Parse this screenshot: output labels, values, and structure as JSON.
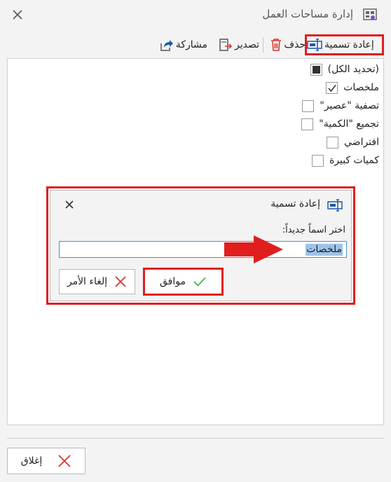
{
  "window": {
    "title": "إدارة مساحات العمل"
  },
  "toolbar": {
    "rename_label": "إعادة تسمية",
    "delete_label": "حذف",
    "export_label": "تصدير",
    "share_label": "مشاركة"
  },
  "list": {
    "items": [
      {
        "label": "(تحديد الكل)",
        "state": "indeterminate"
      },
      {
        "label": "ملخصات",
        "state": "checked"
      },
      {
        "label": "تصفية \"عصير\"",
        "state": "unchecked"
      },
      {
        "label": "تجميع \"الكمية\"",
        "state": "unchecked"
      },
      {
        "label": "افتراضي",
        "state": "unchecked"
      },
      {
        "label": "كميات كبيرة",
        "state": "unchecked"
      }
    ]
  },
  "dialog": {
    "title": "إعادة تسمية",
    "prompt": "اختر اسماً جديداً:",
    "value": "ملخصات",
    "ok_label": "موافق",
    "cancel_label": "إلغاء الأمر"
  },
  "footer": {
    "close_label": "إغلاق"
  },
  "colors": {
    "highlight": "#e01e1e",
    "accent_blue": "#1e5aa8",
    "delete_red": "#d9352e",
    "check_green": "#4caf50"
  }
}
